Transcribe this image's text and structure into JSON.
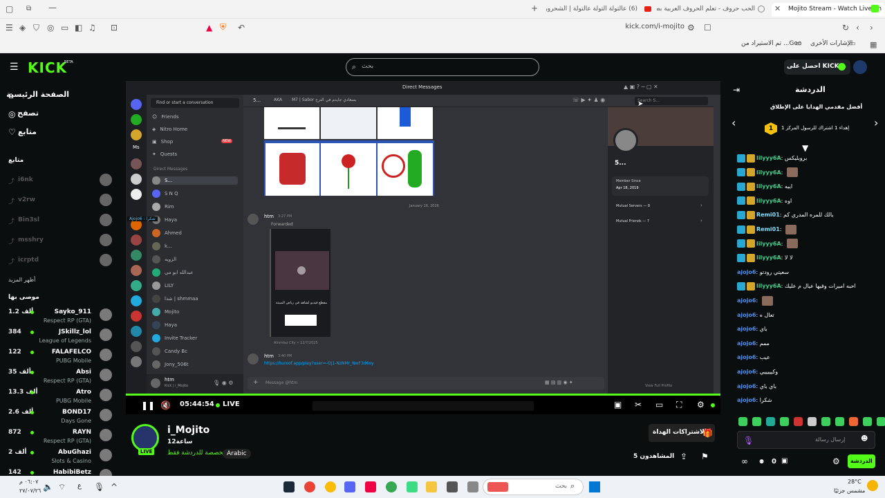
{
  "browser": {
    "tabs": [
      {
        "title": "Mojito Stream - Watch Live on"
      },
      {
        "title": "الحب حروف - تعلم الحروف العربية بطر"
      },
      {
        "title": "(6) عالتولة التولة عالتولة | الشحرورة"
      }
    ],
    "url": "kick.com/i-mojito",
    "bookmarks": {
      "other": "الإشارات الأخرى",
      "imported": "تم الاستيراد من ...Goo"
    }
  },
  "kick": {
    "logo": "KICK",
    "logo_sup": "BETA",
    "search_placeholder": "بحث",
    "get_kicks": "احصل على KICKs",
    "nav": {
      "home": "الصفحة الرئيسية",
      "browse": "تصفح",
      "following": "متابع"
    },
    "following_header": "متابع",
    "followed": [
      {
        "name": "i6nk"
      },
      {
        "name": "v2rw"
      },
      {
        "name": "Bin3sl"
      },
      {
        "name": "msshry"
      },
      {
        "name": "icrptd"
      }
    ],
    "show_more": "أظهر المزيد",
    "recommended_header": "موصى بها",
    "recommended": [
      {
        "name": "Sayko_911",
        "game": "Respect RP (GTA)",
        "viewers": "1.2 ألف"
      },
      {
        "name": "JSkillz_lol",
        "game": "League of Legends",
        "viewers": "384"
      },
      {
        "name": "FALAFELCO",
        "game": "PUBG Mobile",
        "viewers": "122"
      },
      {
        "name": "Absi",
        "game": "Respect RP (GTA)",
        "viewers": "35 ألف"
      },
      {
        "name": "Atro",
        "game": "PUBG Mobile",
        "viewers": "13.3 ألف"
      },
      {
        "name": "BOND17",
        "game": "Days Gone",
        "viewers": "2.6 ألف"
      },
      {
        "name": "RAYN",
        "game": "Respect RP (GTA)",
        "viewers": "872"
      },
      {
        "name": "AbuGhazi",
        "game": "Slots & Casino",
        "viewers": "2 ألف"
      },
      {
        "name": "HabibiBetz",
        "game": "",
        "viewers": "142"
      }
    ]
  },
  "player": {
    "time": "05:44:54",
    "live": "LIVE",
    "discord": {
      "title": "Direct Messages",
      "find": "Find or start a conversation",
      "header_user": "AKA",
      "header_note": "M7 | Sabor بسعادي جايدم في الترح",
      "search": "Search S...",
      "menu": [
        "Friends",
        "Nitro Home",
        "Shop",
        "Quests"
      ],
      "shop_badge": "NEW",
      "dm_header": "Direct Messages",
      "dms": [
        "S...",
        "S N Q",
        "Rim",
        "Haya",
        "Ahmed",
        "k...",
        "الزويه",
        "عبدالله ابو مي",
        "LILY",
        "شذا | shmmaa",
        "Mojito",
        "Haya",
        "Invite Tracker",
        "Candy Bc",
        "Jony_506t"
      ],
      "overlay_chat": "Ajojo6 : شكرا",
      "date_divider": "January 16, 2026",
      "msg_author": "htm",
      "msg_time": "3:27 PM",
      "forwarded": "Forwarded",
      "video_caption": "مقطع فيديو لشاهد في رياض المبيتة",
      "video_sub": "Alnmtaz City • 12/7/2025",
      "msg2_author": "htm",
      "msg2_time": "3:40 PM",
      "link": "https://huroof.app/play?user=-Oj1-NzNMr_NwF3d6oy",
      "input_placeholder": "Message @htm",
      "profile_name": "5...",
      "member_since_label": "Member Since",
      "member_since": "Apr 18, 2019",
      "mutual_servers": "Mutual Servers — 8",
      "mutual_friends": "Mutual Friends — 7",
      "user_panel_name": "htm",
      "user_panel_sub": "Kick | i_Mojito",
      "footer_link": "View Full Profile"
    }
  },
  "stream": {
    "streamer": "i_Mojito",
    "title": "ساعة12",
    "category": "مخصصة للدردشة فقط",
    "language": "Arabic",
    "subscribe": "الاشتراكات الهداة",
    "viewers": "5 المشاهدون",
    "live_badge": "LIVE"
  },
  "chat": {
    "title": "الدردشة",
    "top_gifters_title": "أفضل مقدمي الهدايا على الإطلاق",
    "gifter_rank": "1",
    "gifter_text": "إهداء 1 اشتراك للرسول المركز 1",
    "messages": [
      {
        "user": "lilyyy6A",
        "text": "بروبليكس",
        "color": "#3ecf8e",
        "badges": 2
      },
      {
        "user": "lilyyy6A",
        "text": "",
        "color": "#3ecf8e",
        "badges": 2
      },
      {
        "user": "lilyyy6A",
        "text": "اييه",
        "color": "#3ecf8e",
        "badges": 2
      },
      {
        "user": "lilyyy6A",
        "text": "اوه",
        "color": "#3ecf8e",
        "badges": 2
      },
      {
        "user": "Remi01",
        "text": "بالك للمره المدري كم",
        "color": "#7ee0ff",
        "badges": 2
      },
      {
        "user": "Remi01",
        "text": "",
        "color": "#7ee0ff",
        "badges": 2
      },
      {
        "user": "lilyyy6A",
        "text": "",
        "color": "#3ecf8e",
        "badges": 2
      },
      {
        "user": "lilyyy6A",
        "text": "لا لا",
        "color": "#3ecf8e",
        "badges": 2
      },
      {
        "user": "ajojo6",
        "text": "سعيتي رودتو",
        "color": "#4f8ff0",
        "badges": 0
      },
      {
        "user": "lilyyy6A",
        "text": "احبه اميرات وفيها عيال م عليك",
        "color": "#3ecf8e",
        "badges": 2
      },
      {
        "user": "ajojo6",
        "text": "",
        "color": "#4f8ff0",
        "badges": 0
      },
      {
        "user": "ajojo6",
        "text": "تعال ه",
        "color": "#4f8ff0",
        "badges": 0
      },
      {
        "user": "ajojo6",
        "text": "باي",
        "color": "#4f8ff0",
        "badges": 0
      },
      {
        "user": "ajojo6",
        "text": "ممم",
        "color": "#4f8ff0",
        "badges": 0
      },
      {
        "user": "ajojo6",
        "text": "عيب",
        "color": "#4f8ff0",
        "badges": 0
      },
      {
        "user": "ajojo6",
        "text": "وكيييييي",
        "color": "#4f8ff0",
        "badges": 0
      },
      {
        "user": "ajojo6",
        "text": "باي باي",
        "color": "#4f8ff0",
        "badges": 0
      },
      {
        "user": "ajojo6",
        "text": "شكرا",
        "color": "#4f8ff0",
        "badges": 0
      }
    ],
    "input_placeholder": "إرسال رسالة",
    "send": "الدردشة",
    "points": "0"
  },
  "taskbar": {
    "search_placeholder": "بحث",
    "time": "٠٦:٠٧ م",
    "date": "٢٧/٠٧/٢٦",
    "lang": "ع",
    "weather_temp": "28°C",
    "weather_desc": "مشمس جزئيًا"
  },
  "colors": {
    "kick_green": "#53fc18",
    "bg": "#0b0e0f",
    "discord": "#313338"
  }
}
